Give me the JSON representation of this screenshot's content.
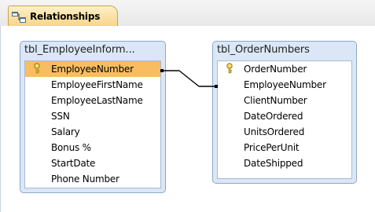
{
  "tab": {
    "label": "Relationships",
    "icon": "relationships-icon"
  },
  "tables": [
    {
      "title": "tbl_EmployeeInform...",
      "fields": [
        {
          "name": "EmployeeNumber",
          "primary_key": true,
          "selected": true
        },
        {
          "name": "EmployeeFirstName"
        },
        {
          "name": "EmployeeLastName"
        },
        {
          "name": "SSN"
        },
        {
          "name": "Salary"
        },
        {
          "name": "Bonus %"
        },
        {
          "name": "StartDate"
        },
        {
          "name": "Phone Number"
        }
      ]
    },
    {
      "title": "tbl_OrderNumbers",
      "fields": [
        {
          "name": "OrderNumber",
          "primary_key": true
        },
        {
          "name": "EmployeeNumber"
        },
        {
          "name": "ClientNumber"
        },
        {
          "name": "DateOrdered"
        },
        {
          "name": "UnitsOrdered"
        },
        {
          "name": "PricePerUnit"
        },
        {
          "name": "DateShipped"
        }
      ]
    }
  ],
  "relationship": {
    "from_table": "tbl_EmployeeInform...",
    "from_field": "EmployeeNumber",
    "to_table": "tbl_OrderNumbers",
    "to_field": "EmployeeNumber"
  },
  "colors": {
    "selected_row": "#f8bd61",
    "tab_bg": "#f6d58a",
    "window_frame": "#dbe7f6",
    "key": "#c9a227"
  }
}
